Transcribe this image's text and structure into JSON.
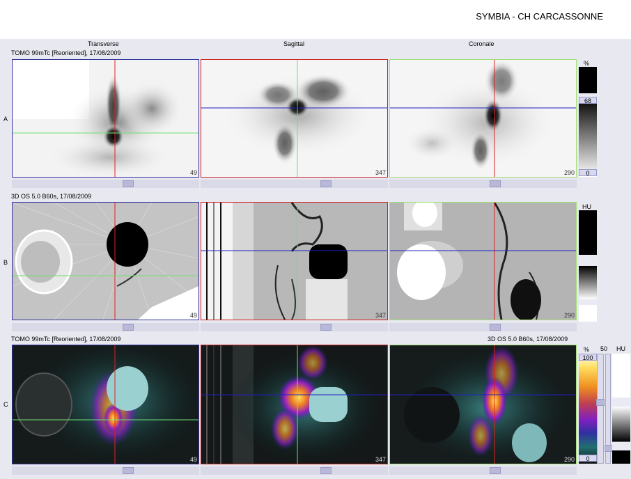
{
  "header": {
    "title": "SYMBIA - CH CARCASSONNE"
  },
  "columns": {
    "transverse": "Transverse",
    "sagittal": "Sagittal",
    "coronal": "Coronale"
  },
  "rows": {
    "a": {
      "label": "A",
      "series": "TOMO 99mTc [Reoriented], 17/08/2009",
      "scale_unit": "%",
      "scale_top": "68",
      "scale_bottom": "0",
      "slices": [
        "49",
        "347",
        "290"
      ]
    },
    "b": {
      "label": "B",
      "series": "3D  OS  5.0  B60s, 17/08/2009",
      "scale_unit": "HU",
      "slices": [
        "49",
        "347",
        "290"
      ]
    },
    "c": {
      "label": "C",
      "series_left": "TOMO 99mTc [Reoriented], 17/08/2009",
      "series_right": "3D  OS  5.0  B60s, 17/08/2009",
      "scale_unit": "%",
      "scale_top": "100",
      "scale_bottom": "0",
      "scale2_top": "50",
      "scale2_unit": "HU",
      "slices": [
        "49",
        "347",
        "290"
      ]
    }
  },
  "colors": {
    "transverse_border": "#3030a0",
    "sagittal_border": "#d02020",
    "coronal_border": "#a0e070",
    "crosshair_red": "#e02020",
    "crosshair_green": "#70e070",
    "crosshair_blue": "#2020c0"
  }
}
